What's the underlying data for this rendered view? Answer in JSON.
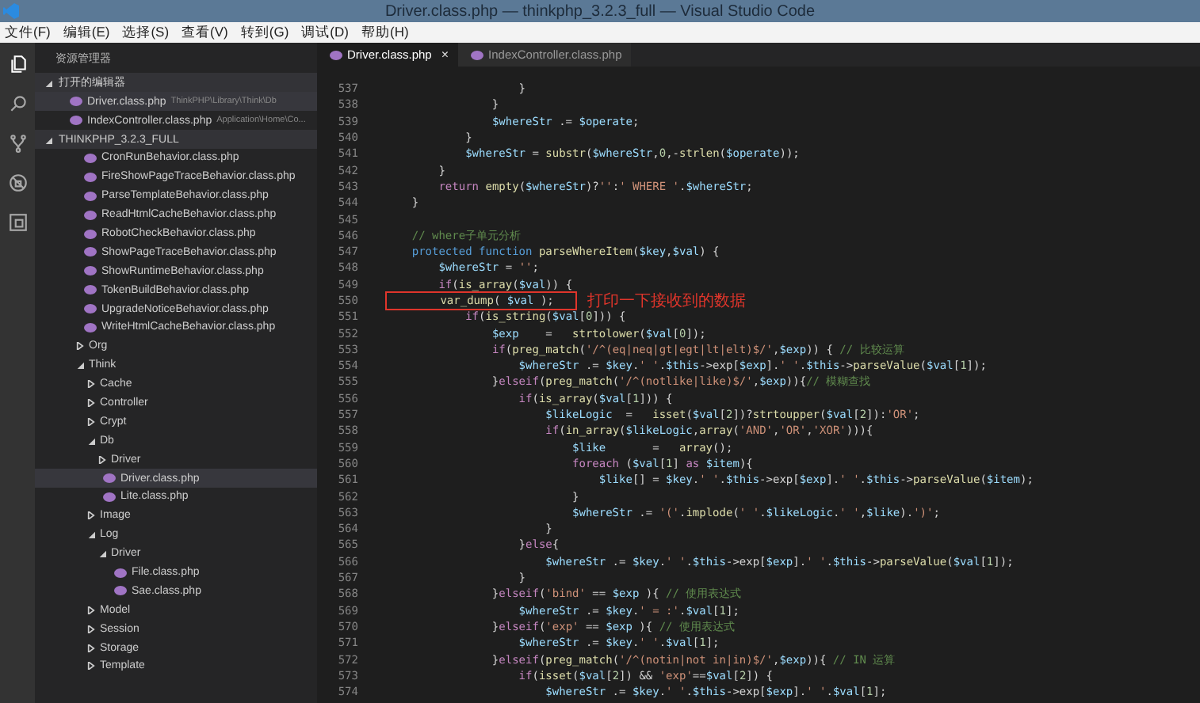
{
  "window": {
    "title": "Driver.class.php — thinkphp_3.2.3_full — Visual Studio Code"
  },
  "menu": [
    "文件(F)",
    "编辑(E)",
    "选择(S)",
    "查看(V)",
    "转到(G)",
    "调试(D)",
    "帮助(H)"
  ],
  "activity_bar": [
    {
      "kind": "files",
      "selected": true
    },
    {
      "kind": "search",
      "selected": false
    },
    {
      "kind": "git",
      "selected": false
    },
    {
      "kind": "debug",
      "selected": false
    },
    {
      "kind": "extensions",
      "selected": false
    }
  ],
  "sidebar": {
    "title": "资源管理器",
    "open_editors": {
      "title": "打开的编辑器",
      "expanded": true,
      "items": [
        {
          "name": "Driver.class.php",
          "path": "ThinkPHP\\Library\\Think\\Db",
          "selected": true
        },
        {
          "name": "IndexController.class.php",
          "path": "Application\\Home\\Co...",
          "selected": false
        }
      ]
    },
    "project": {
      "title": "THINKPHP_3.2.3_FULL",
      "expanded": true,
      "top_files": [
        "CronRunBehavior.class.php",
        "FireShowPageTraceBehavior.class.php",
        "ParseTemplateBehavior.class.php",
        "ReadHtmlCacheBehavior.class.php",
        "RobotCheckBehavior.class.php",
        "ShowPageTraceBehavior.class.php",
        "ShowRuntimeBehavior.class.php",
        "TokenBuildBehavior.class.php",
        "UpgradeNoticeBehavior.class.php",
        "WriteHtmlCacheBehavior.class.php"
      ],
      "tree": [
        {
          "kind": "folder",
          "name": "Org",
          "expanded": false
        },
        {
          "kind": "folder",
          "name": "Think",
          "expanded": true,
          "children": [
            {
              "kind": "folder",
              "name": "Cache",
              "expanded": false
            },
            {
              "kind": "folder",
              "name": "Controller",
              "expanded": false
            },
            {
              "kind": "folder",
              "name": "Crypt",
              "expanded": false
            },
            {
              "kind": "folder",
              "name": "Db",
              "expanded": true,
              "children": [
                {
                  "kind": "folder",
                  "name": "Driver",
                  "expanded": false
                },
                {
                  "kind": "file",
                  "name": "Driver.class.php",
                  "selected": true
                },
                {
                  "kind": "file",
                  "name": "Lite.class.php",
                  "selected": false
                }
              ]
            },
            {
              "kind": "folder",
              "name": "Image",
              "expanded": false
            },
            {
              "kind": "folder",
              "name": "Log",
              "expanded": true,
              "children": [
                {
                  "kind": "folder",
                  "name": "Driver",
                  "expanded": true,
                  "children": [
                    {
                      "kind": "file",
                      "name": "File.class.php",
                      "selected": false
                    },
                    {
                      "kind": "file",
                      "name": "Sae.class.php",
                      "selected": false
                    }
                  ]
                }
              ]
            },
            {
              "kind": "folder",
              "name": "Model",
              "expanded": false
            },
            {
              "kind": "folder",
              "name": "Session",
              "expanded": false
            },
            {
              "kind": "folder",
              "name": "Storage",
              "expanded": false
            },
            {
              "kind": "folder",
              "name": "Template",
              "expanded": false
            }
          ]
        }
      ]
    }
  },
  "tabs": [
    {
      "label": "Driver.class.php",
      "selected": true,
      "close": "×"
    },
    {
      "label": "IndexController.class.php",
      "selected": false
    }
  ],
  "code": [
    {
      "n": "537",
      "text": "                    }"
    },
    {
      "n": "538",
      "text": "                }"
    },
    {
      "n": "539",
      "text": "                $whereStr .= $operate;"
    },
    {
      "n": "540",
      "text": "            }"
    },
    {
      "n": "541",
      "text": "            $whereStr = substr($whereStr,0,-strlen($operate));"
    },
    {
      "n": "542",
      "text": "        }"
    },
    {
      "n": "543",
      "text": "        return empty($whereStr)?'':' WHERE '.$whereStr;"
    },
    {
      "n": "544",
      "text": "    }"
    },
    {
      "n": "545"
    },
    {
      "n": "546",
      "text": "    // where子单元分析"
    },
    {
      "n": "547",
      "text": "    protected function parseWhereItem($key,$val) {"
    },
    {
      "n": "548",
      "text": "        $whereStr = '';"
    },
    {
      "n": "549",
      "text": "        if(is_array($val)) {"
    },
    {
      "n": "550",
      "text": "            var_dump( $val );",
      "annotation": "打印一下接收到的数据"
    },
    {
      "n": "551",
      "text": "            if(is_string($val[0])) {"
    },
    {
      "n": "552",
      "text": "                $exp    =   strtolower($val[0]);"
    },
    {
      "n": "553",
      "text": "                if(preg_match('/^(eq|neq|gt|egt|lt|elt)$/',$exp)) { // 比较运算"
    },
    {
      "n": "554",
      "text": "                    $whereStr .= $key.' '.$this->exp[$exp].' '.$this->parseValue($val[1]);"
    },
    {
      "n": "555",
      "text": "                }elseif(preg_match('/^(notlike|like)$/',$exp)){// 模糊查找"
    },
    {
      "n": "556",
      "text": "                    if(is_array($val[1])) {"
    },
    {
      "n": "557",
      "text": "                        $likeLogic  =   isset($val[2])?strtoupper($val[2]):'OR';"
    },
    {
      "n": "558",
      "text": "                        if(in_array($likeLogic,array('AND','OR','XOR'))){"
    },
    {
      "n": "559",
      "text": "                            $like       =   array();"
    },
    {
      "n": "560",
      "text": "                            foreach ($val[1] as $item){"
    },
    {
      "n": "561",
      "text": "                                $like[] = $key.' '.$this->exp[$exp].' '.$this->parseValue($item);"
    },
    {
      "n": "562",
      "text": "                            }"
    },
    {
      "n": "563",
      "text": "                            $whereStr .= '('.implode(' '.$likeLogic.' ',$like).')';"
    },
    {
      "n": "564",
      "text": "                        }"
    },
    {
      "n": "565",
      "text": "                    }else{"
    },
    {
      "n": "566",
      "text": "                        $whereStr .= $key.' '.$this->exp[$exp].' '.$this->parseValue($val[1]);"
    },
    {
      "n": "567",
      "text": "                    }"
    },
    {
      "n": "568",
      "text": "                }elseif('bind' == $exp ){ // 使用表达式"
    },
    {
      "n": "569",
      "text": "                    $whereStr .= $key.' = :'.$val[1];"
    },
    {
      "n": "570",
      "text": "                }elseif('exp' == $exp ){ // 使用表达式"
    },
    {
      "n": "571",
      "text": "                    $whereStr .= $key.' '.$val[1];"
    },
    {
      "n": "572",
      "text": "                }elseif(preg_match('/^(notin|not in|in)$/',$exp)){ // IN 运算"
    },
    {
      "n": "573",
      "text": "                    if(isset($val[2]) && 'exp'==$val[2]) {"
    },
    {
      "n": "574",
      "text": "                        $whereStr .= $key.' '.$this->exp[$exp].' '.$val[1];"
    }
  ]
}
